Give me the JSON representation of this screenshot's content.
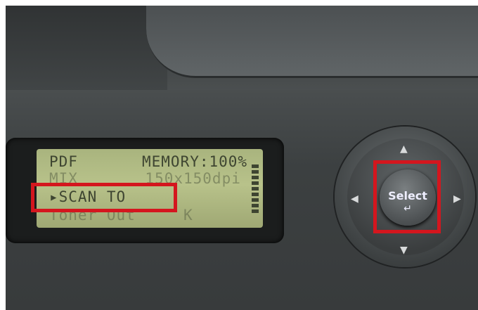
{
  "lcd": {
    "line1_left": "PDF",
    "line1_right": "MEMORY:100%",
    "line2": "MIX       150x150dpi",
    "line3": "▸SCAN TO",
    "line4": "Toner Out     K"
  },
  "control_panel": {
    "select_label": "Select",
    "enter_symbol": "↵",
    "arrows": {
      "up": "▲",
      "down": "▼",
      "left": "◀",
      "right": "▶"
    }
  },
  "highlight_color": "#d4161e"
}
